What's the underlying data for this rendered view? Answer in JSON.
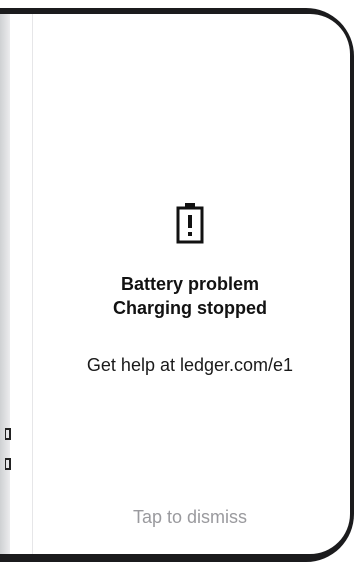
{
  "screen": {
    "icon": "battery-warning-icon",
    "title_line1": "Battery problem",
    "title_line2": "Charging stopped",
    "help_text": "Get help at ledger.com/e1",
    "dismiss_label": "Tap to dismiss"
  },
  "colors": {
    "bezel": "#1b1b1d",
    "title": "#121212",
    "body_text": "#1a1a1a",
    "dismiss_text": "#9a9a9e"
  }
}
